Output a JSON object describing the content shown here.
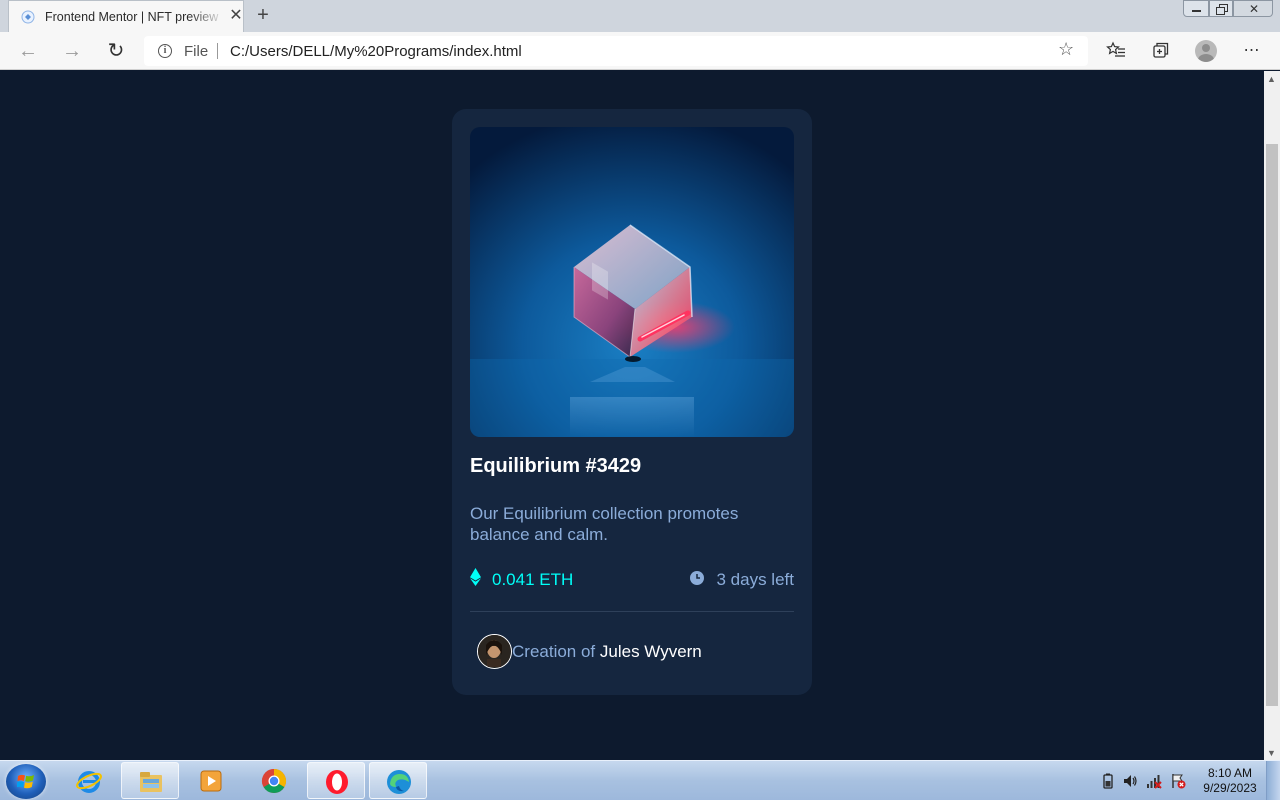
{
  "browser": {
    "tab_title": "Frontend Mentor | NFT preview card component",
    "tab_close": "✕",
    "new_tab": "+",
    "address_protocol_label": "File",
    "url": "C:/Users/DELL/My%20Programs/index.html"
  },
  "window_controls": {
    "close_glyph": "✕"
  },
  "card": {
    "title": "Equilibrium #3429",
    "description": "Our Equilibrium collection promotes balance and calm.",
    "price": "0.041 ETH",
    "time_left": "3 days left",
    "creator_prefix": "Creation of ",
    "creator_name": "Jules Wyvern"
  },
  "colors": {
    "page_bg": "#0d1a2e",
    "card_bg": "#15263f",
    "cyan_accent": "#00fff8",
    "soft_blue": "#8bacd9",
    "white": "#ffffff"
  },
  "taskbar": {
    "time": "8:10 AM",
    "date": "9/29/2023",
    "apps": [
      "internet-explorer",
      "file-explorer",
      "media-player",
      "chrome",
      "opera",
      "edge"
    ]
  }
}
